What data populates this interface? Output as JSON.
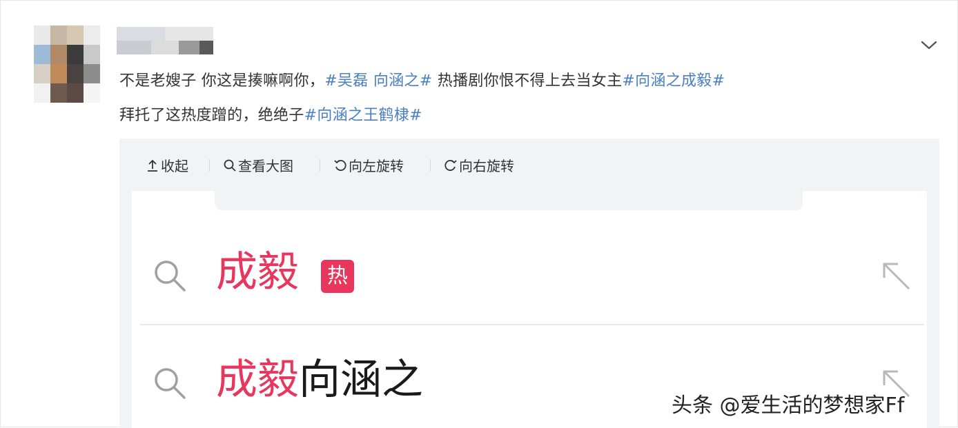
{
  "post": {
    "line1_text": "不是老嫂子 你这是揍嘛啊你，",
    "line1_tag1": "#吴磊 向涵之#",
    "line1_mid": " 热播剧你恨不得上去当女主",
    "line1_tag2": "#向涵之成毅#",
    "line2_text": "拜托了这热度蹭的，绝绝子",
    "line2_tag": "#向涵之王鹤棣#"
  },
  "toolbar": {
    "collapse": "收起",
    "view_large": "查看大图",
    "rotate_left": "向左旋转",
    "rotate_right": "向右旋转"
  },
  "results": [
    {
      "highlight": "成毅",
      "rest": "",
      "badge": "热"
    },
    {
      "highlight": "成毅",
      "rest": "向涵之",
      "badge": ""
    }
  ],
  "watermark": "头条 @爱生活的梦想家Ff",
  "colors": {
    "tag_blue": "#4a7fc1",
    "hot_pink": "#e8365d"
  },
  "icons": [
    "chevron-down-icon",
    "collapse-up-icon",
    "zoom-icon",
    "rotate-left-icon",
    "rotate-right-icon",
    "search-icon",
    "arrow-up-left-icon"
  ]
}
